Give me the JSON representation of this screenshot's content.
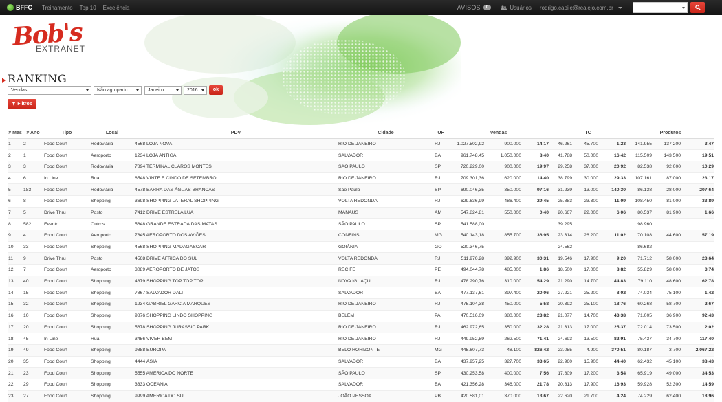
{
  "topbar": {
    "brand": "BFFC",
    "nav": [
      "Treinamento",
      "Top 10",
      "Excelência"
    ],
    "avisos_label": "AVISOS",
    "avisos_count": "0",
    "users_label": "Usuários",
    "user_email": "rodrigo.capile@realejo.com.br"
  },
  "logo": {
    "main": "Bob's",
    "sub": "EXTRANET"
  },
  "page": {
    "title": "RANKING"
  },
  "filters": {
    "metric": "Vendas",
    "grouping": "Não agrupado",
    "month": "Janeiro",
    "year": "2016",
    "ok_label": "ok",
    "filtros_label": "Filtros"
  },
  "table": {
    "headers": {
      "mes": "# Mes",
      "ano": "# Ano",
      "tipo": "Tipo",
      "local": "Local",
      "pdv": "PDV",
      "cidade": "Cidade",
      "uf": "UF",
      "vendas": "Vendas",
      "tc": "TC",
      "produtos": "Produtos"
    },
    "rows": [
      [
        "1",
        "2",
        "Food Court",
        "Rodoviária",
        "4568 LOJA NOVA",
        "RIO DE JANEIRO",
        "RJ",
        "1.027.502,92",
        "900.000",
        "14,17",
        "46.261",
        "45.700",
        "1,23",
        "141.955",
        "137.200",
        "3,47"
      ],
      [
        "2",
        "1",
        "Food Court",
        "Aeroporto",
        "1234 LOJA ANTIGA",
        "SALVADOR",
        "BA",
        "961.748,45",
        "1.050.000",
        "8,40",
        "41.788",
        "50.000",
        "16,42",
        "115.509",
        "143.500",
        "19,51"
      ],
      [
        "3",
        "3",
        "Food Court",
        "Rodoviária",
        "7894 TERMINAL CLAROS MONTES",
        "SÃO PAULO",
        "SP",
        "720.229,00",
        "900.000",
        "19,97",
        "29.258",
        "37.000",
        "20,92",
        "82.538",
        "92.000",
        "10,29"
      ],
      [
        "4",
        "6",
        "In Line",
        "Rua",
        "6548 VINTE E CINDO DE SETEMBRO",
        "RIO DE JANEIRO",
        "RJ",
        "709.301,36",
        "620.000",
        "14,40",
        "38.799",
        "30.000",
        "29,33",
        "107.161",
        "87.000",
        "23,17"
      ],
      [
        "5",
        "183",
        "Food Court",
        "Rodoviária",
        "4578 BARRA DAS ÁGUAS BRANCAS",
        "São Paulo",
        "SP",
        "690.046,35",
        "350.000",
        "97,16",
        "31.239",
        "13.000",
        "140,30",
        "86.138",
        "28.000",
        "207,64"
      ],
      [
        "6",
        "8",
        "Food Court",
        "Shopping",
        "3698 SHOPPING LATERAL SHOPPING",
        "VOLTA REDONDA",
        "RJ",
        "629.636,99",
        "486.400",
        "29,45",
        "25.883",
        "23.300",
        "11,09",
        "108.450",
        "81.000",
        "33,89"
      ],
      [
        "7",
        "5",
        "Drive Thru",
        "Posto",
        "7412 DRIVE ESTRELA LUA",
        "MANAUS",
        "AM",
        "547.824,81",
        "550.000",
        "0,40",
        "20.667",
        "22.000",
        "6,06",
        "80.537",
        "81.900",
        "1,66"
      ],
      [
        "8",
        "582",
        "Evento",
        "Outros",
        "5648 GRANDE ESTRADA DAS MATAS",
        "SÃO PAULO",
        "SP",
        "541.588,00",
        "",
        "",
        "39.295",
        "",
        "",
        "98.960",
        "",
        ""
      ],
      [
        "9",
        "4",
        "Food Court",
        "Aeroporto",
        "7845 AEROPORTO DOS AVIÕES",
        "CONFINS",
        "MG",
        "540.143,18",
        "855.700",
        "36,95",
        "23.314",
        "26.200",
        "11,02",
        "70.108",
        "44.600",
        "57,19"
      ],
      [
        "10",
        "33",
        "Food Court",
        "Shopping",
        "4568 SHOPPING MADAGASCAR",
        "GOIÂNIA",
        "GO",
        "520.346,75",
        "",
        "",
        "24.562",
        "",
        "",
        "86.682",
        "",
        ""
      ],
      [
        "11",
        "9",
        "Drive Thru",
        "Posto",
        "4568 DRIVE AFRICA DO SUL",
        "VOLTA REDONDA",
        "RJ",
        "511.970,28",
        "392.900",
        "30,31",
        "19.546",
        "17.900",
        "9,20",
        "71.712",
        "58.000",
        "23,64"
      ],
      [
        "12",
        "7",
        "Food Court",
        "Aeroporto",
        "3089 AEROPORTO DE JATOS",
        "RECIFE",
        "PE",
        "494.044,78",
        "485.000",
        "1,86",
        "18.500",
        "17.000",
        "8,82",
        "55.829",
        "58.000",
        "3,74"
      ],
      [
        "13",
        "40",
        "Food Court",
        "Shopping",
        "4879 SHOPPING TOP TOP TOP",
        "NOVA IGUAÇU",
        "RJ",
        "478.290,76",
        "310.000",
        "54,29",
        "21.290",
        "14.700",
        "44,83",
        "79.110",
        "48.600",
        "62,78"
      ],
      [
        "14",
        "15",
        "Food Court",
        "Shopping",
        "7867 SALVADOR DALI",
        "SALVADOR",
        "BA",
        "477.137,61",
        "397.400",
        "20,06",
        "27.221",
        "25.200",
        "8,02",
        "74.034",
        "75.100",
        "1,42"
      ],
      [
        "15",
        "32",
        "Food Court",
        "Shopping",
        "1234 GABRIEL GARCIA MARQUES",
        "RIO DE JANEIRO",
        "RJ",
        "475.104,38",
        "450.000",
        "5,58",
        "20.392",
        "25.100",
        "18,76",
        "60.268",
        "58.700",
        "2,67"
      ],
      [
        "16",
        "10",
        "Food Court",
        "Shopping",
        "9876 SHOPPING LINDO SHOPPING",
        "BELÉM",
        "PA",
        "470.516,09",
        "380.000",
        "23,82",
        "21.077",
        "14.700",
        "43,38",
        "71.005",
        "36.900",
        "92,43"
      ],
      [
        "17",
        "20",
        "Food Court",
        "Shopping",
        "5678 SHOPPING JURASSIC PARK",
        "RIO DE JANEIRO",
        "RJ",
        "462.972,65",
        "350.000",
        "32,28",
        "21.313",
        "17.000",
        "25,37",
        "72.014",
        "73.500",
        "2,02"
      ],
      [
        "18",
        "45",
        "In Line",
        "Rua",
        "3456 VIVER BEM",
        "RIO DE JANEIRO",
        "RJ",
        "449.952,89",
        "262.500",
        "71,41",
        "24.693",
        "13.500",
        "82,91",
        "75.437",
        "34.700",
        "117,40"
      ],
      [
        "19",
        "49",
        "Food Court",
        "Shopping",
        "9888 EUROPA",
        "BELO HORIZONTE",
        "MG",
        "445.607,73",
        "48.100",
        "826,42",
        "23.055",
        "4.900",
        "370,51",
        "80.187",
        "3.700",
        "2.067,22"
      ],
      [
        "20",
        "35",
        "Food Court",
        "Shopping",
        "4444 ÁSIA",
        "SALVADOR",
        "BA",
        "437.957,25",
        "327.700",
        "33,65",
        "22.960",
        "15.900",
        "44,40",
        "62.432",
        "45.100",
        "38,43"
      ],
      [
        "21",
        "23",
        "Food Court",
        "Shopping",
        "5555 AMERICA DO NORTE",
        "SÃO PAULO",
        "SP",
        "430.253,58",
        "400.000",
        "7,56",
        "17.809",
        "17.200",
        "3,54",
        "65.919",
        "49.000",
        "34,53"
      ],
      [
        "22",
        "29",
        "Food Court",
        "Shopping",
        "3333 OCEANIA",
        "SALVADOR",
        "BA",
        "421.356,28",
        "346.000",
        "21,78",
        "20.813",
        "17.900",
        "16,93",
        "59.928",
        "52.300",
        "14,59"
      ],
      [
        "23",
        "27",
        "Food Court",
        "Shopping",
        "9999 AMERICA DO SUL",
        "JOÃO PESSOA",
        "PB",
        "420.581,01",
        "370.000",
        "13,67",
        "22.620",
        "21.700",
        "4,24",
        "74.229",
        "62.400",
        "18,96"
      ]
    ],
    "negative_cells": [
      [
        1,
        9
      ],
      [
        1,
        12
      ],
      [
        1,
        15
      ],
      [
        2,
        9
      ],
      [
        2,
        12
      ],
      [
        2,
        15
      ],
      [
        3,
        15
      ],
      [
        5,
        12
      ],
      [
        6,
        9
      ],
      [
        6,
        12
      ],
      [
        6,
        15
      ],
      [
        8,
        9
      ],
      [
        8,
        12
      ],
      [
        11,
        15
      ],
      [
        13,
        12
      ],
      [
        13,
        15
      ],
      [
        14,
        12
      ],
      [
        16,
        15
      ]
    ]
  },
  "colors": {
    "accent": "#d62b1f",
    "positive": "#2a3fd4",
    "negative": "#e02a1f",
    "topbar": "#1b1b1b"
  }
}
